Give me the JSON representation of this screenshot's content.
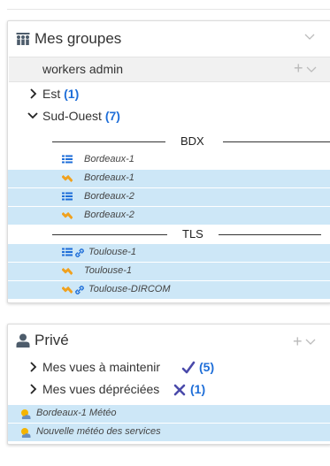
{
  "groups_panel": {
    "title": "Mes groupes",
    "workgroup": "workers admin",
    "tree": [
      {
        "label": "Est",
        "count": "(1)"
      },
      {
        "label": "Sud-Ouest",
        "count": "(7)"
      }
    ],
    "separators": [
      "BDX",
      "TLS"
    ],
    "items": [
      {
        "label": "Bordeaux-1"
      },
      {
        "label": "Bordeaux-1"
      },
      {
        "label": "Bordeaux-2"
      },
      {
        "label": "Bordeaux-2"
      },
      {
        "label": "Toulouse-1"
      },
      {
        "label": "Toulouse-1"
      },
      {
        "label": "Toulouse-DIRCOM"
      }
    ]
  },
  "prive_panel": {
    "title": "Privé",
    "rows": [
      {
        "label": "Mes vues à maintenir",
        "count": "(5)"
      },
      {
        "label": "Mes vues dépréciées",
        "count": "(1)"
      }
    ],
    "items": [
      {
        "label": "Bordeaux-1 Météo"
      },
      {
        "label": "Nouvelle météo des services"
      }
    ]
  },
  "colors": {
    "accent": "#1e6ed8",
    "selected_bg": "#cde7f7",
    "check": "#4a4aaa",
    "cross": "#4a4aaa"
  }
}
